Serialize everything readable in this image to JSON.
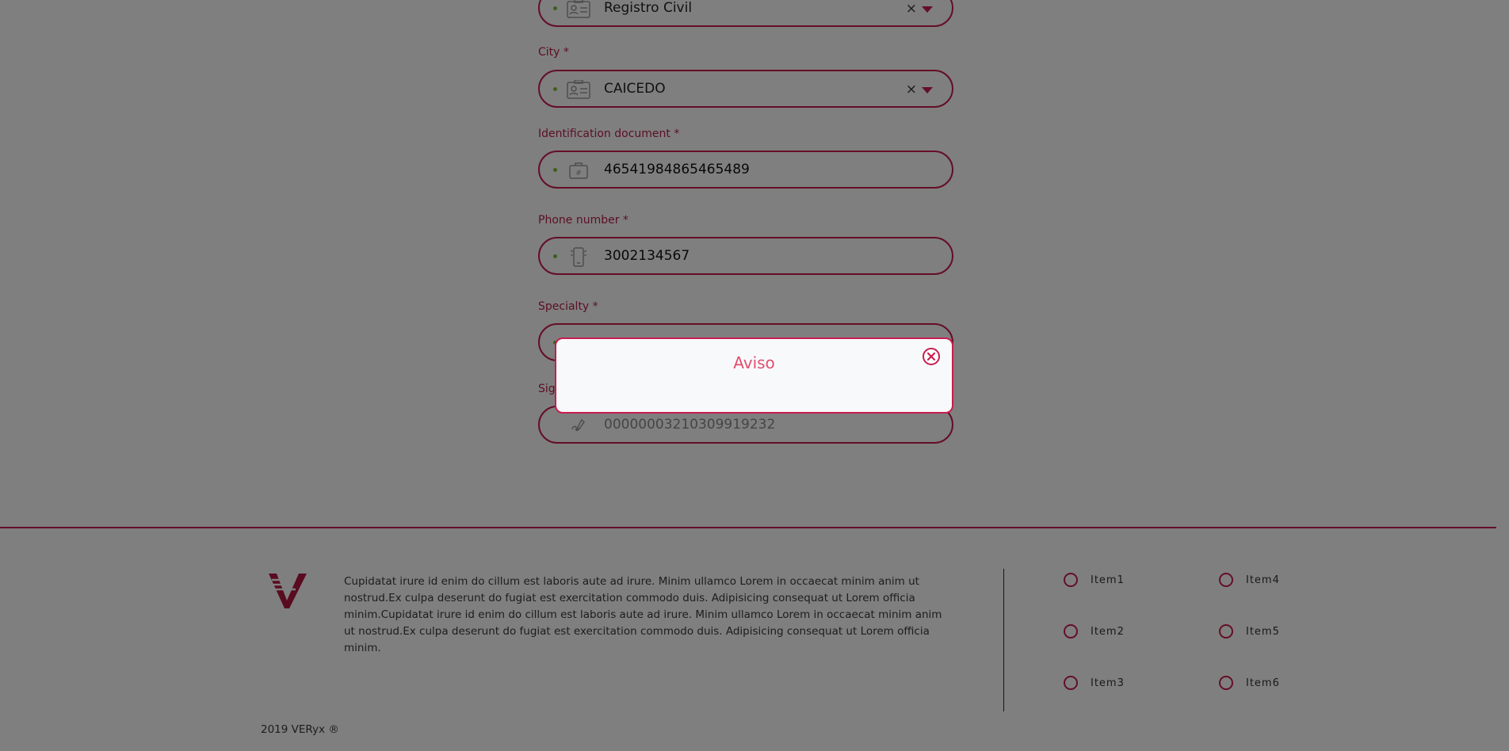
{
  "form": {
    "registry": {
      "value": "Registro Civil"
    },
    "city": {
      "label": "City *",
      "value": "CAICEDO"
    },
    "id_doc": {
      "label": "Identification document *",
      "value": "46541984865465489"
    },
    "phone": {
      "label": "Phone number *",
      "value": "3002134567"
    },
    "specialty": {
      "label": "Specialty *"
    },
    "signature": {
      "label": "Sig",
      "value": "00000003210309919232"
    },
    "clear_glyph": "×"
  },
  "modal": {
    "title": "Aviso",
    "close_icon": "close-circle-icon"
  },
  "footer": {
    "body_text": "Cupidatat irure id enim do cillum est laboris aute ad irure. Minim ullamco Lorem in occaecat minim anim ut nostrud.Ex culpa deserunt do fugiat est exercitation commodo duis. Adipisicing consequat ut Lorem officia minim.Cupidatat irure id enim do cillum est laboris aute ad irure. Minim ullamco Lorem in occaecat minim anim ut nostrud.Ex culpa deserunt do fugiat est exercitation commodo duis. Adipisicing consequat ut Lorem officia minim.",
    "items": [
      "Item1",
      "Item2",
      "Item3",
      "Item4",
      "Item5",
      "Item6"
    ],
    "copyright": "2019 VERyx ®"
  },
  "colors": {
    "accent": "#c81d4e",
    "modal_title": "#e0506e",
    "status_dot": "#7bbf3a",
    "overlay": "rgba(0,0,0,0.5)"
  }
}
